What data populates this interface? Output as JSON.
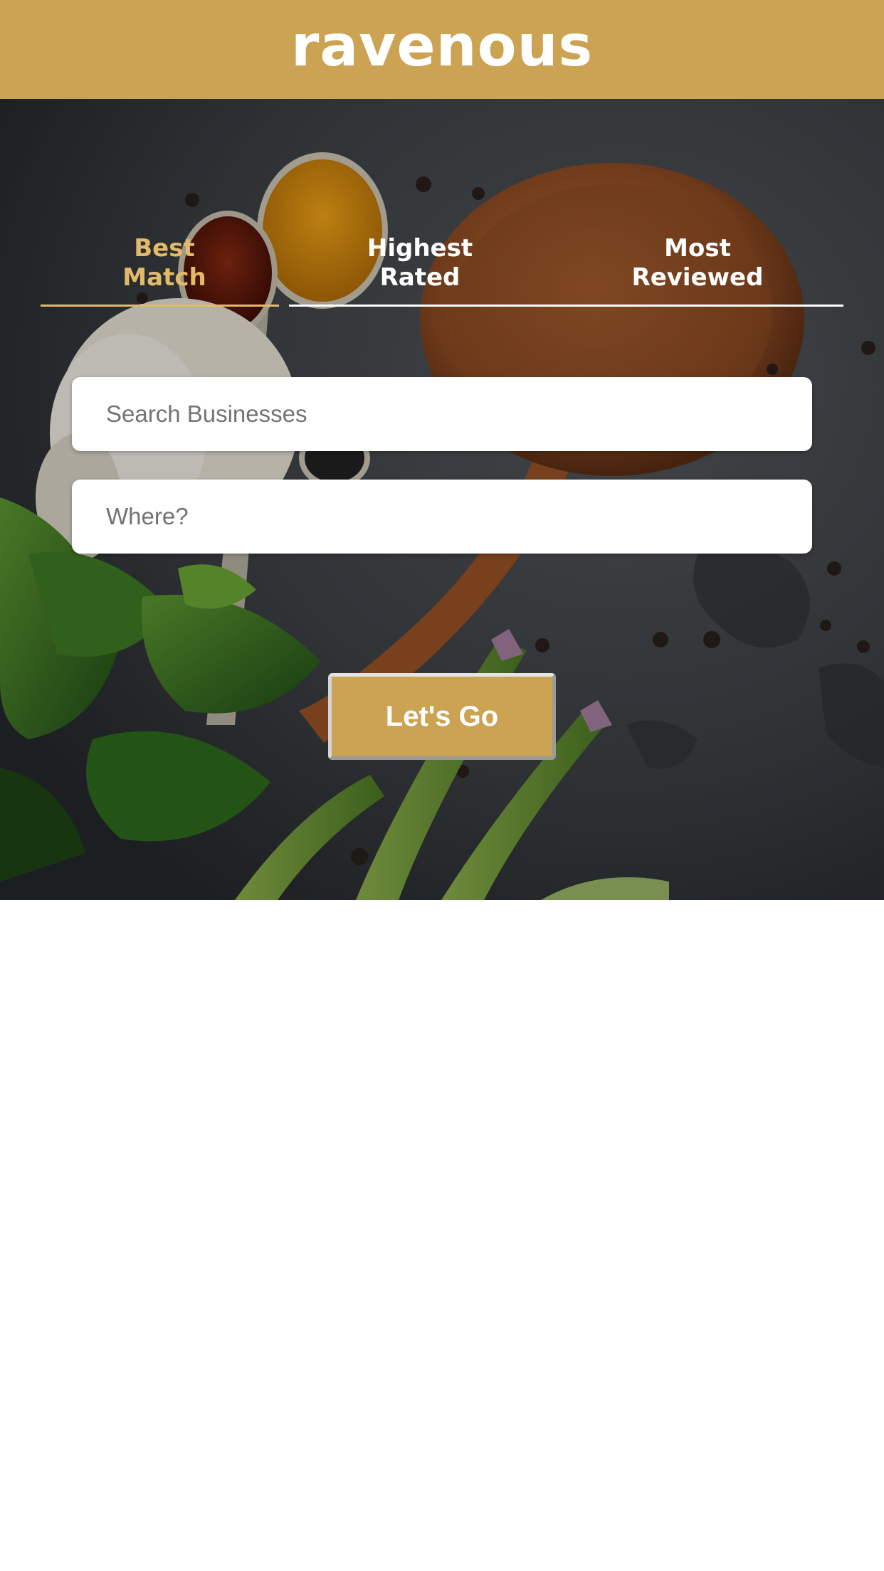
{
  "app": {
    "title": "ravenous"
  },
  "colors": {
    "brand": "#cca353",
    "active_tab": "#e2ba6a",
    "text_light": "#ffffff"
  },
  "sort_tabs": [
    {
      "label": "Best Match",
      "active": true
    },
    {
      "label": "Highest Rated",
      "active": false
    },
    {
      "label": "Most Reviewed",
      "active": false
    }
  ],
  "search": {
    "term_placeholder": "Search Businesses",
    "term_value": "",
    "location_placeholder": "Where?",
    "location_value": ""
  },
  "submit": {
    "label": "Let's Go"
  }
}
